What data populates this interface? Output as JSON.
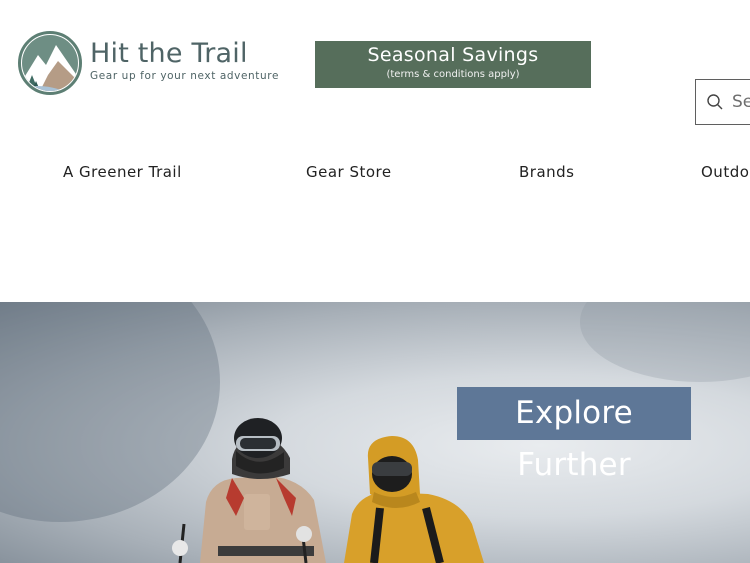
{
  "header": {
    "logo_title": "Hit the Trail",
    "logo_tagline": "Gear up for your next adventure",
    "promo_title": "Seasonal Savings",
    "promo_subtitle": "(terms & conditions apply)",
    "search_placeholder": "Search",
    "search_icon": "search-icon"
  },
  "nav": {
    "items": [
      {
        "label": "A Greener Trail"
      },
      {
        "label": "Gear Store"
      },
      {
        "label": "Brands"
      },
      {
        "label": "Outdoor"
      }
    ]
  },
  "hero": {
    "cta_label": "Explore Further",
    "image_subject": "two skiers in winter jackets and goggles on a snowy ridge"
  },
  "colors": {
    "promo_bg": "#566e5b",
    "cta_bg": "#5e7797",
    "logo_text": "#4f6466"
  }
}
